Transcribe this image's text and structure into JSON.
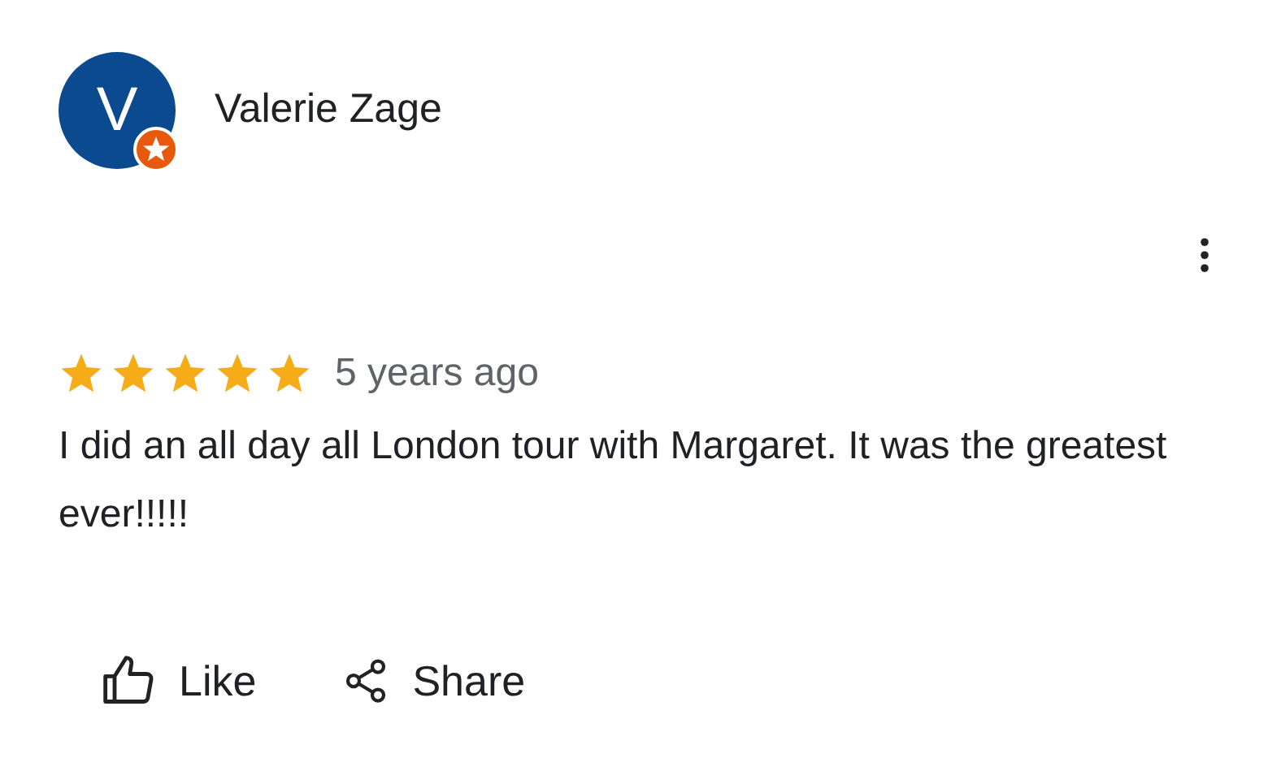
{
  "review": {
    "author": "Valerie Zage",
    "avatar_letter": "V",
    "local_guide": true,
    "stars": 5,
    "time": "5 years ago",
    "text": "I did an all day all London tour with Margaret. It was the greatest ever!!!!!"
  },
  "actions": [
    {
      "kind": "like",
      "label": "Like"
    },
    {
      "kind": "share",
      "label": "Share"
    }
  ]
}
